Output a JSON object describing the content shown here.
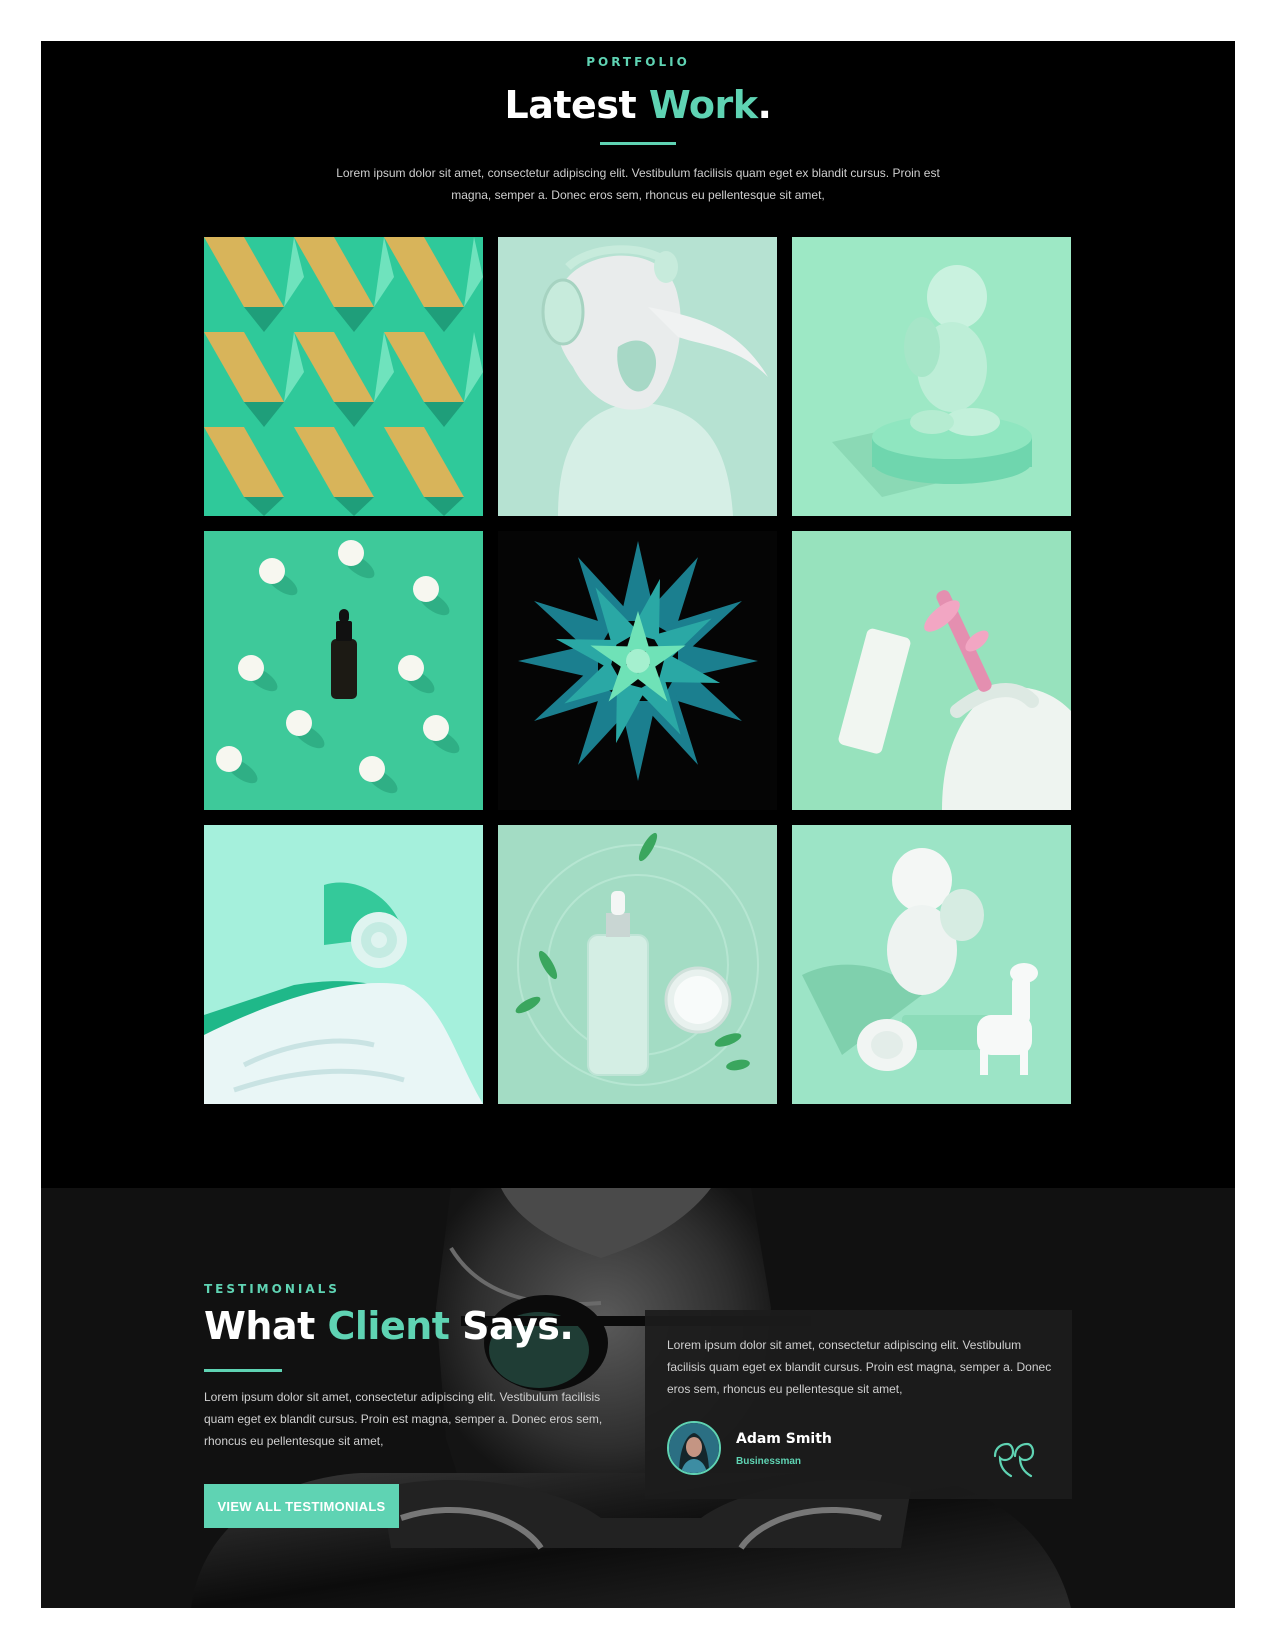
{
  "colors": {
    "accent": "#5fd3b3",
    "page_bg": "#000000",
    "text_muted": "#cfcfcf"
  },
  "portfolio": {
    "eyebrow": "PORTFOLIO",
    "title_part1": "Latest ",
    "title_accent": "Work",
    "title_end": ".",
    "intro": "Lorem ipsum dolor sit amet, consectetur adipiscing elit. Vestibulum facilisis quam eget ex blandit cursus. Proin est magna, semper a. Donec eros sem, rhoncus eu pellentesque sit amet,",
    "items": [
      {
        "subject": "geometric-paper-pattern"
      },
      {
        "subject": "woman-with-headphones"
      },
      {
        "subject": "cherub-statue-on-pedestal"
      },
      {
        "subject": "serum-bottle-with-spheres"
      },
      {
        "subject": "paper-flower"
      },
      {
        "subject": "face-roller-and-cream-tube"
      },
      {
        "subject": "rose-and-white-fabric"
      },
      {
        "subject": "serum-bottle-and-cream-jar"
      },
      {
        "subject": "cherub-and-llama-figurine"
      }
    ]
  },
  "testimonials": {
    "eyebrow": "TESTIMONIALS",
    "title_part1": "What ",
    "title_accent": "Client",
    "title_end": " Says.",
    "text": "Lorem ipsum dolor sit amet, consectetur adipiscing elit. Vestibulum facilisis quam eget ex blandit cursus. Proin est magna, semper a. Donec eros sem, rhoncus eu pellentesque sit amet,",
    "button_label": "VIEW ALL TESTIMONIALS",
    "card": {
      "quote": "Lorem ipsum dolor sit amet, consectetur adipiscing elit. Vestibulum facilisis quam eget ex blandit cursus. Proin est magna, semper a. Donec eros sem, rhoncus eu pellentesque sit amet,",
      "name": "Adam Smith",
      "role": "Businessman",
      "icon": "quote-icon"
    }
  }
}
